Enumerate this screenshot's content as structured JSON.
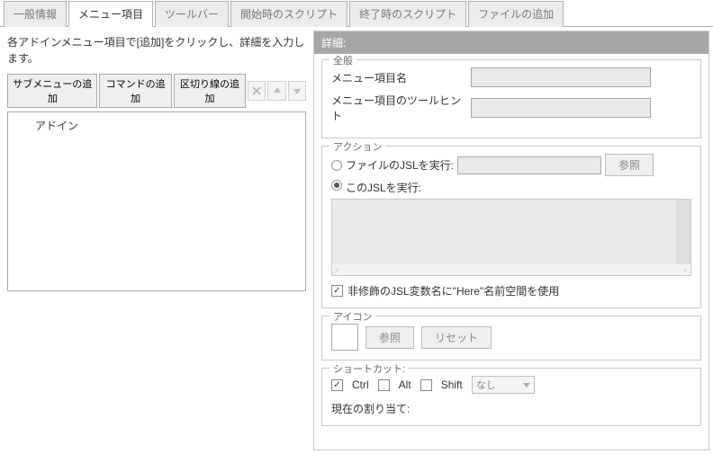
{
  "tabs": [
    {
      "label": "一般情報",
      "active": false
    },
    {
      "label": "メニュー項目",
      "active": true
    },
    {
      "label": "ツールバー",
      "active": false
    },
    {
      "label": "開始時のスクリプト",
      "active": false
    },
    {
      "label": "終了時のスクリプト",
      "active": false
    },
    {
      "label": "ファイルの追加",
      "active": false
    }
  ],
  "instruction": "各アドインメニュー項目で[追加]をクリックし、詳細を入力します。",
  "toolbar": {
    "add_submenu": "サブメニューの追加",
    "add_command": "コマンドの追加",
    "add_separator": "区切り線の追加"
  },
  "tree": {
    "items": [
      "アドイン"
    ]
  },
  "detail": {
    "header": "詳細:",
    "general": {
      "legend": "全般",
      "name_label": "メニュー項目名",
      "name_value": "",
      "tooltip_label": "メニュー項目のツールヒント",
      "tooltip_value": ""
    },
    "action": {
      "legend": "アクション",
      "run_file_label": "ファイルのJSLを実行:",
      "run_this_label": "このJSLを実行:",
      "browse": "参照",
      "file_value": "",
      "script_value": "",
      "here_checkbox": "非修飾のJSL変数名に\"Here\"名前空間を使用",
      "here_checked": true
    },
    "icon": {
      "legend": "アイコン",
      "browse": "参照",
      "reset": "リセット"
    },
    "shortcut": {
      "legend": "ショートカット:",
      "ctrl": "Ctrl",
      "alt": "Alt",
      "shift": "Shift",
      "key_none": "なし",
      "ctrl_checked": true,
      "alt_checked": false,
      "shift_checked": false,
      "current_label": "現在の割り当て:",
      "current_value": ""
    }
  }
}
